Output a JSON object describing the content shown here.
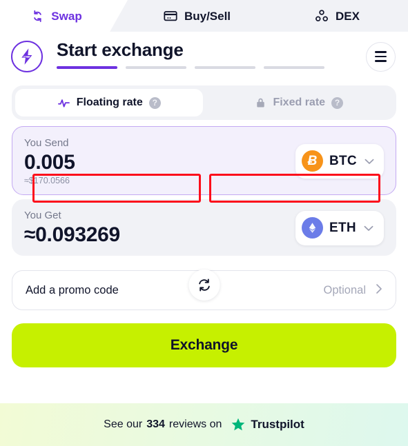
{
  "tabs": [
    {
      "label": "Swap",
      "icon": "swap-vertical-icon",
      "active": true
    },
    {
      "label": "Buy/Sell",
      "icon": "credit-card-icon",
      "active": false
    },
    {
      "label": "DEX",
      "icon": "dex-nodes-icon",
      "active": false
    }
  ],
  "header": {
    "logo_icon": "lightning-bolt-logo",
    "title": "Start exchange",
    "menu_icon": "hamburger-menu-icon",
    "steps_total": 4,
    "steps_active": 1
  },
  "rate_switch": {
    "floating": {
      "label": "Floating rate",
      "icon": "pulse-wave-icon",
      "help": "?",
      "active": true
    },
    "fixed": {
      "label": "Fixed rate",
      "icon": "lock-icon",
      "help": "?",
      "active": false
    }
  },
  "send": {
    "label": "You Send",
    "amount": "0.005",
    "fiat": "≈$170.0566",
    "coin_ticker": "BTC",
    "coin_symbol": "Ƀ",
    "coin_color": "#f7931a",
    "chevron": "⌄"
  },
  "get": {
    "label": "You Get",
    "amount": "≈0.093269",
    "coin_ticker": "ETH",
    "coin_color": "#6b7ce8",
    "chevron": "⌄"
  },
  "swap_button": {
    "icon": "swap-refresh-icon"
  },
  "promo": {
    "label": "Add a promo code",
    "optional": "Optional",
    "arrow": "›"
  },
  "exchange_button": {
    "label": "Exchange",
    "color": "#c6f000"
  },
  "footer": {
    "prefix": "See our",
    "count": "334",
    "middle": "reviews on",
    "brand": "Trustpilot",
    "star_color": "#00b67a"
  },
  "annotations": [
    {
      "name": "floating-rate-highlight",
      "color": "#fc0d1b"
    },
    {
      "name": "fixed-rate-highlight",
      "color": "#fc0d1b"
    }
  ]
}
